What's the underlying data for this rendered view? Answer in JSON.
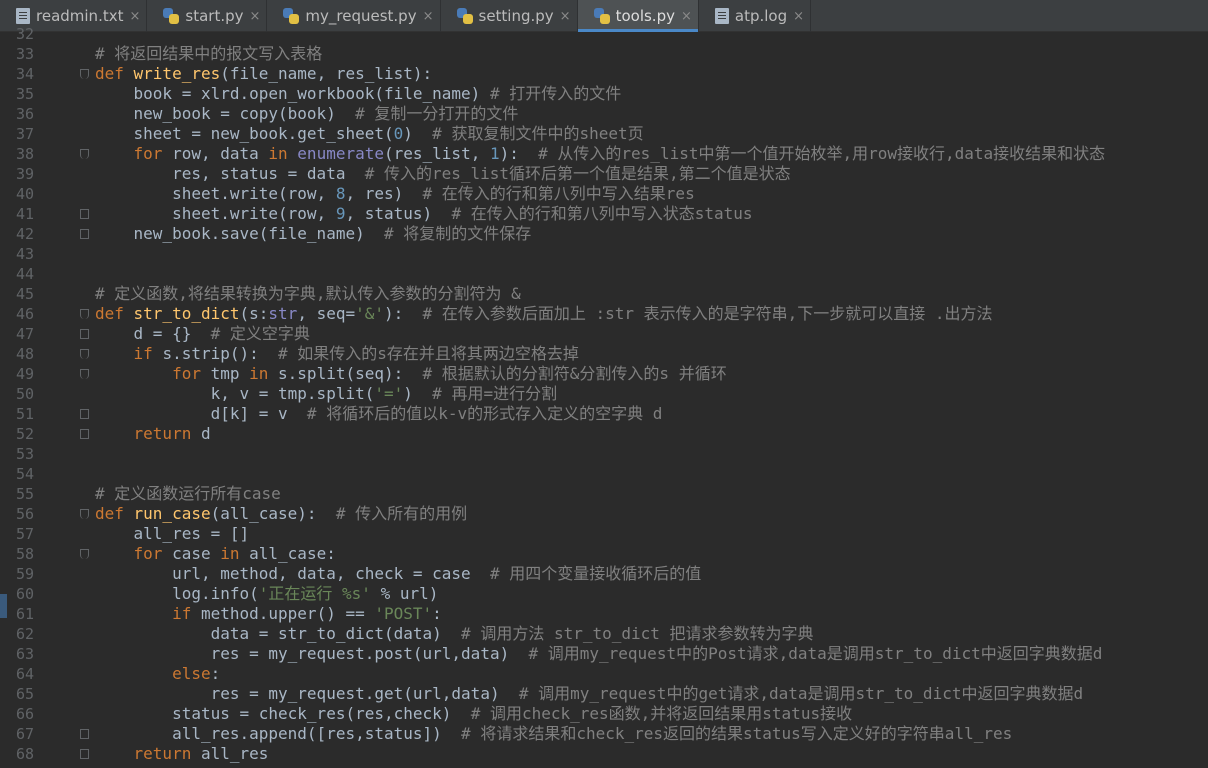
{
  "tabs": [
    {
      "label": "readmin.txt",
      "icon": "text-file-icon",
      "active": false
    },
    {
      "label": "start.py",
      "icon": "python-file-icon",
      "active": false
    },
    {
      "label": "my_request.py",
      "icon": "python-file-icon",
      "active": false
    },
    {
      "label": "setting.py",
      "icon": "python-file-icon",
      "active": false
    },
    {
      "label": "tools.py",
      "icon": "python-file-icon",
      "active": true
    },
    {
      "label": "atp.log",
      "icon": "text-file-icon",
      "active": false
    }
  ],
  "close_glyph": "×",
  "lines": [
    {
      "n": "32",
      "t": [
        {
          "k": "pl",
          "s": ""
        }
      ]
    },
    {
      "n": "33",
      "t": [
        {
          "k": "cm",
          "s": "# 将返回结果中的报文写入表格"
        }
      ]
    },
    {
      "n": "34",
      "t": [
        {
          "k": "kw",
          "s": "def "
        },
        {
          "k": "fn",
          "s": "write_res"
        },
        {
          "k": "pl",
          "s": "(file_name, res_list):"
        }
      ]
    },
    {
      "n": "35",
      "t": [
        {
          "k": "pl",
          "s": "    book = xlrd.open_workbook(file_name) "
        },
        {
          "k": "cm",
          "s": "# 打开传入的文件"
        }
      ]
    },
    {
      "n": "36",
      "t": [
        {
          "k": "pl",
          "s": "    new_book = copy(book)  "
        },
        {
          "k": "cm",
          "s": "# 复制一分打开的文件"
        }
      ]
    },
    {
      "n": "37",
      "t": [
        {
          "k": "pl",
          "s": "    sheet = new_book.get_sheet("
        },
        {
          "k": "nu",
          "s": "0"
        },
        {
          "k": "pl",
          "s": ")  "
        },
        {
          "k": "cm",
          "s": "# 获取复制文件中的sheet页"
        }
      ]
    },
    {
      "n": "38",
      "t": [
        {
          "k": "kw",
          "s": "    for "
        },
        {
          "k": "pl",
          "s": "row, data "
        },
        {
          "k": "kw",
          "s": "in "
        },
        {
          "k": "bi",
          "s": "enumerate"
        },
        {
          "k": "pl",
          "s": "(res_list, "
        },
        {
          "k": "nu",
          "s": "1"
        },
        {
          "k": "pl",
          "s": "):  "
        },
        {
          "k": "cm",
          "s": "# 从传入的res_list中第一个值开始枚举,用row接收行,data接收结果和状态"
        }
      ]
    },
    {
      "n": "39",
      "t": [
        {
          "k": "pl",
          "s": "        res, status = data  "
        },
        {
          "k": "cm",
          "s": "# 传入的res_list循环后第一个值是结果,第二个值是状态"
        }
      ]
    },
    {
      "n": "40",
      "t": [
        {
          "k": "pl",
          "s": "        sheet.write(row, "
        },
        {
          "k": "nu",
          "s": "8"
        },
        {
          "k": "pl",
          "s": ", res)  "
        },
        {
          "k": "cm",
          "s": "# 在传入的行和第八列中写入结果res"
        }
      ]
    },
    {
      "n": "41",
      "t": [
        {
          "k": "pl",
          "s": "        sheet.write(row, "
        },
        {
          "k": "nu",
          "s": "9"
        },
        {
          "k": "pl",
          "s": ", status)  "
        },
        {
          "k": "cm",
          "s": "# 在传入的行和第八列中写入状态status"
        }
      ]
    },
    {
      "n": "42",
      "t": [
        {
          "k": "pl",
          "s": "    new_book.save(file_name)  "
        },
        {
          "k": "cm",
          "s": "# 将复制的文件保存"
        }
      ]
    },
    {
      "n": "43",
      "t": [
        {
          "k": "pl",
          "s": ""
        }
      ]
    },
    {
      "n": "44",
      "t": [
        {
          "k": "pl",
          "s": ""
        }
      ]
    },
    {
      "n": "45",
      "t": [
        {
          "k": "cm",
          "s": "# 定义函数,将结果转换为字典,默认传入参数的分割符为 &"
        }
      ]
    },
    {
      "n": "46",
      "t": [
        {
          "k": "kw",
          "s": "def "
        },
        {
          "k": "fn",
          "s": "str_to_dict"
        },
        {
          "k": "pl",
          "s": "(s:"
        },
        {
          "k": "bi",
          "s": "str"
        },
        {
          "k": "pl",
          "s": ", seq="
        },
        {
          "k": "st",
          "s": "'&'"
        },
        {
          "k": "pl",
          "s": "):  "
        },
        {
          "k": "cm",
          "s": "# 在传入参数后面加上 :str 表示传入的是字符串,下一步就可以直接 .出方法"
        }
      ]
    },
    {
      "n": "47",
      "t": [
        {
          "k": "pl",
          "s": "    d = {}  "
        },
        {
          "k": "cm",
          "s": "# 定义空字典"
        }
      ]
    },
    {
      "n": "48",
      "t": [
        {
          "k": "kw",
          "s": "    if "
        },
        {
          "k": "pl",
          "s": "s.strip():  "
        },
        {
          "k": "cm",
          "s": "# 如果传入的s存在并且将其两边空格去掉"
        }
      ]
    },
    {
      "n": "49",
      "t": [
        {
          "k": "kw",
          "s": "        for "
        },
        {
          "k": "pl",
          "s": "tmp "
        },
        {
          "k": "kw",
          "s": "in "
        },
        {
          "k": "pl",
          "s": "s.split(seq):  "
        },
        {
          "k": "cm",
          "s": "# 根据默认的分割符&分割传入的s 并循环"
        }
      ]
    },
    {
      "n": "50",
      "t": [
        {
          "k": "pl",
          "s": "            k, v = tmp.split("
        },
        {
          "k": "st",
          "s": "'='"
        },
        {
          "k": "pl",
          "s": ")  "
        },
        {
          "k": "cm",
          "s": "# 再用=进行分割"
        }
      ]
    },
    {
      "n": "51",
      "t": [
        {
          "k": "pl",
          "s": "            d[k] = v  "
        },
        {
          "k": "cm",
          "s": "# 将循环后的值以k-v的形式存入定义的空字典 d"
        }
      ]
    },
    {
      "n": "52",
      "t": [
        {
          "k": "kw",
          "s": "    return "
        },
        {
          "k": "pl",
          "s": "d"
        }
      ]
    },
    {
      "n": "53",
      "t": [
        {
          "k": "pl",
          "s": ""
        }
      ]
    },
    {
      "n": "54",
      "t": [
        {
          "k": "pl",
          "s": ""
        }
      ]
    },
    {
      "n": "55",
      "t": [
        {
          "k": "cm",
          "s": "# 定义函数运行所有case"
        }
      ]
    },
    {
      "n": "56",
      "t": [
        {
          "k": "kw",
          "s": "def "
        },
        {
          "k": "fn",
          "s": "run_case"
        },
        {
          "k": "pl",
          "s": "(all_case):  "
        },
        {
          "k": "cm",
          "s": "# 传入所有的用例"
        }
      ]
    },
    {
      "n": "57",
      "t": [
        {
          "k": "pl",
          "s": "    all_res = []"
        }
      ]
    },
    {
      "n": "58",
      "t": [
        {
          "k": "kw",
          "s": "    for "
        },
        {
          "k": "pl",
          "s": "case "
        },
        {
          "k": "kw",
          "s": "in "
        },
        {
          "k": "pl",
          "s": "all_case:"
        }
      ]
    },
    {
      "n": "59",
      "t": [
        {
          "k": "pl",
          "s": "        url, method, data, check = case  "
        },
        {
          "k": "cm",
          "s": "# 用四个变量接收循环后的值"
        }
      ]
    },
    {
      "n": "60",
      "t": [
        {
          "k": "pl",
          "s": "        log.info("
        },
        {
          "k": "st",
          "s": "'正在运行 %s'"
        },
        {
          "k": "pl",
          "s": " % url)"
        }
      ]
    },
    {
      "n": "61",
      "t": [
        {
          "k": "kw",
          "s": "        if "
        },
        {
          "k": "pl",
          "s": "method.upper() == "
        },
        {
          "k": "st",
          "s": "'POST'"
        },
        {
          "k": "pl",
          "s": ":"
        }
      ]
    },
    {
      "n": "62",
      "t": [
        {
          "k": "pl",
          "s": "            data = str_to_dict(data)  "
        },
        {
          "k": "cm",
          "s": "# 调用方法 str_to_dict 把请求参数转为字典"
        }
      ]
    },
    {
      "n": "63",
      "t": [
        {
          "k": "pl",
          "s": "            res = my_request.post(url,data)  "
        },
        {
          "k": "cm",
          "s": "# 调用my_request中的Post请求,data是调用str_to_dict中返回字典数据d"
        }
      ]
    },
    {
      "n": "64",
      "t": [
        {
          "k": "kw",
          "s": "        else"
        },
        {
          "k": "pl",
          "s": ":"
        }
      ]
    },
    {
      "n": "65",
      "t": [
        {
          "k": "pl",
          "s": "            res = my_request.get(url,data)  "
        },
        {
          "k": "cm",
          "s": "# 调用my_request中的get请求,data是调用str_to_dict中返回字典数据d"
        }
      ]
    },
    {
      "n": "66",
      "t": [
        {
          "k": "pl",
          "s": "        status = check_res(res,check)  "
        },
        {
          "k": "cm",
          "s": "# 调用check_res函数,并将返回结果用status接收"
        }
      ]
    },
    {
      "n": "67",
      "t": [
        {
          "k": "pl",
          "s": "        all_res.append([res,status])  "
        },
        {
          "k": "cm",
          "s": "# 将请求结果和check_res返回的结果status写入定义好的字符串all_res"
        }
      ]
    },
    {
      "n": "68",
      "t": [
        {
          "k": "kw",
          "s": "    return "
        },
        {
          "k": "pl",
          "s": "all_res"
        }
      ]
    }
  ]
}
